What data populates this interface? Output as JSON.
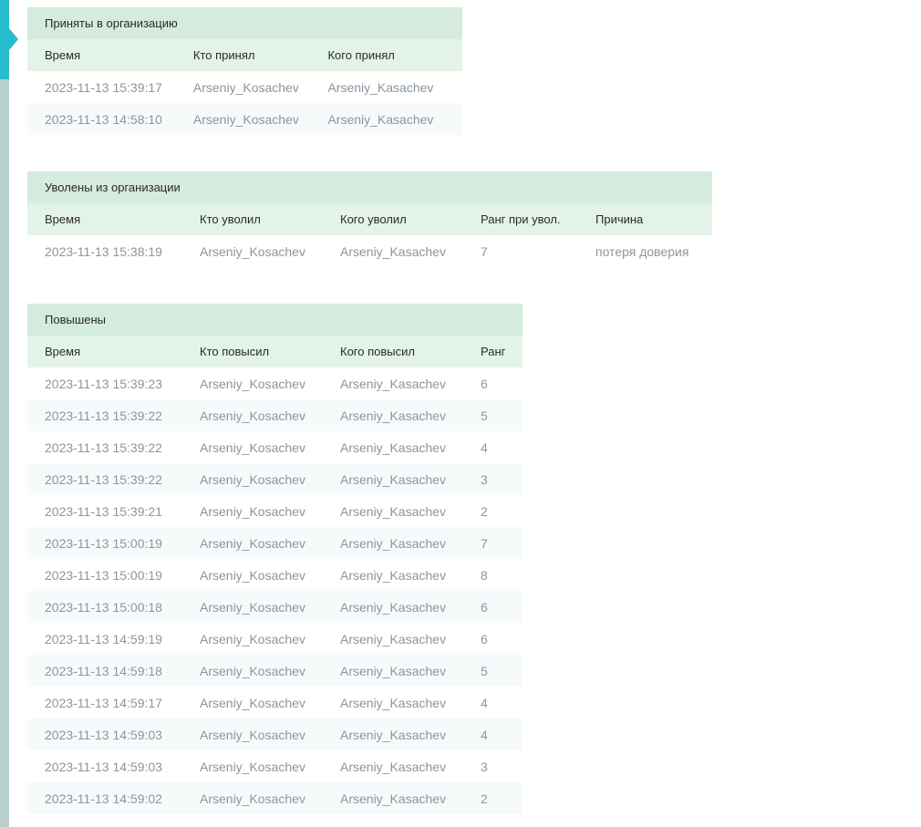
{
  "colors": {
    "rail": "#b7cfcd",
    "rail_active": "#27bccb",
    "section_header_bg": "#d4ebdd",
    "column_header_bg": "#e3f3e8",
    "row_alt_bg": "#f7fafb",
    "row_text": "#8a96a0"
  },
  "accepted": {
    "title": "Приняты в организацию",
    "columns": [
      "Время",
      "Кто принял",
      "Кого принял"
    ],
    "rows": [
      {
        "time": "2023-11-13 15:39:17",
        "who": "Arseniy_Kosachev",
        "whom": "Arseniy_Kasachev"
      },
      {
        "time": "2023-11-13 14:58:10",
        "who": "Arseniy_Kosachev",
        "whom": "Arseniy_Kasachev"
      }
    ]
  },
  "fired": {
    "title": "Уволены из организации",
    "columns": [
      "Время",
      "Кто уволил",
      "Кого уволил",
      "Ранг при увол.",
      "Причина"
    ],
    "rows": [
      {
        "time": "2023-11-13 15:38:19",
        "who": "Arseniy_Kosachev",
        "whom": "Arseniy_Kasachev",
        "rank": "7",
        "reason": "потеря доверия"
      }
    ]
  },
  "promoted": {
    "title": "Повышены",
    "columns": [
      "Время",
      "Кто повысил",
      "Кого повысил",
      "Ранг"
    ],
    "rows": [
      {
        "time": "2023-11-13 15:39:23",
        "who": "Arseniy_Kosachev",
        "whom": "Arseniy_Kasachev",
        "rank": "6"
      },
      {
        "time": "2023-11-13 15:39:22",
        "who": "Arseniy_Kosachev",
        "whom": "Arseniy_Kasachev",
        "rank": "5"
      },
      {
        "time": "2023-11-13 15:39:22",
        "who": "Arseniy_Kosachev",
        "whom": "Arseniy_Kasachev",
        "rank": "4"
      },
      {
        "time": "2023-11-13 15:39:22",
        "who": "Arseniy_Kosachev",
        "whom": "Arseniy_Kasachev",
        "rank": "3"
      },
      {
        "time": "2023-11-13 15:39:21",
        "who": "Arseniy_Kosachev",
        "whom": "Arseniy_Kasachev",
        "rank": "2"
      },
      {
        "time": "2023-11-13 15:00:19",
        "who": "Arseniy_Kosachev",
        "whom": "Arseniy_Kasachev",
        "rank": "7"
      },
      {
        "time": "2023-11-13 15:00:19",
        "who": "Arseniy_Kosachev",
        "whom": "Arseniy_Kasachev",
        "rank": "8"
      },
      {
        "time": "2023-11-13 15:00:18",
        "who": "Arseniy_Kosachev",
        "whom": "Arseniy_Kasachev",
        "rank": "6"
      },
      {
        "time": "2023-11-13 14:59:19",
        "who": "Arseniy_Kosachev",
        "whom": "Arseniy_Kasachev",
        "rank": "6"
      },
      {
        "time": "2023-11-13 14:59:18",
        "who": "Arseniy_Kosachev",
        "whom": "Arseniy_Kasachev",
        "rank": "5"
      },
      {
        "time": "2023-11-13 14:59:17",
        "who": "Arseniy_Kosachev",
        "whom": "Arseniy_Kasachev",
        "rank": "4"
      },
      {
        "time": "2023-11-13 14:59:03",
        "who": "Arseniy_Kosachev",
        "whom": "Arseniy_Kasachev",
        "rank": "4"
      },
      {
        "time": "2023-11-13 14:59:03",
        "who": "Arseniy_Kosachev",
        "whom": "Arseniy_Kasachev",
        "rank": "3"
      },
      {
        "time": "2023-11-13 14:59:02",
        "who": "Arseniy_Kosachev",
        "whom": "Arseniy_Kasachev",
        "rank": "2"
      }
    ]
  }
}
